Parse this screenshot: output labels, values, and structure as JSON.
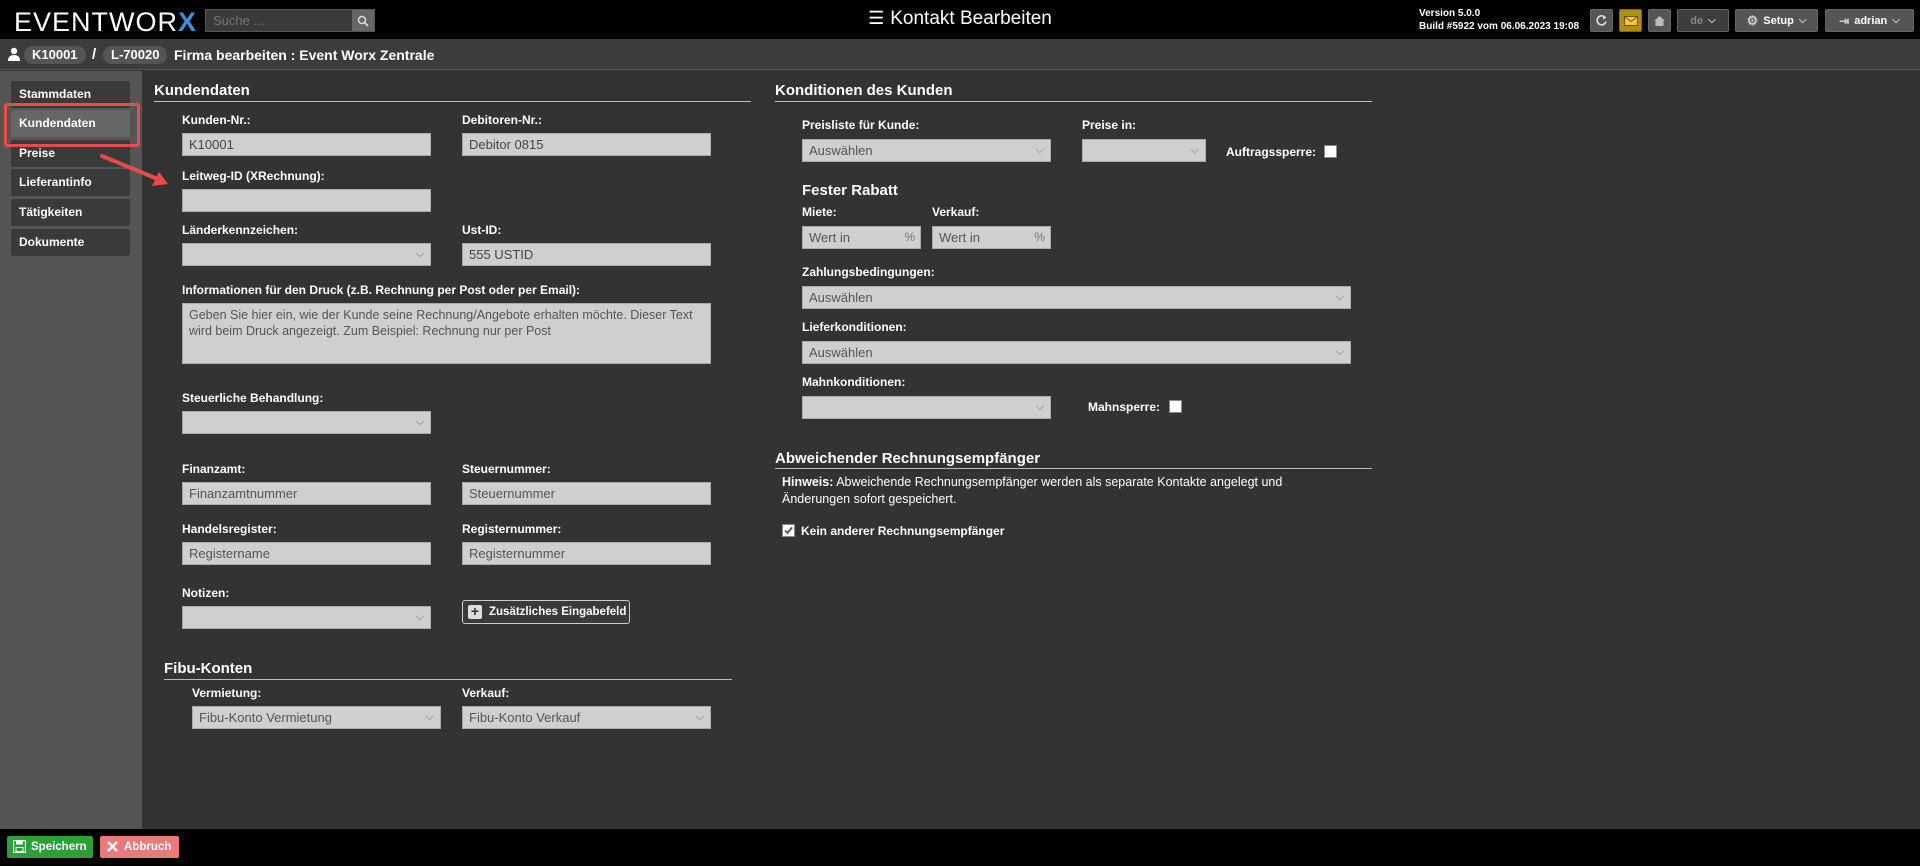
{
  "topbar": {
    "logo_text": "EVENTWOR",
    "logo_x": "X",
    "search_placeholder": "Suche ...",
    "page_title": "Kontakt Bearbeiten",
    "version_line1": "Version 5.0.0",
    "version_line2": "Build #5922 vom 06.06.2023 19:08",
    "lang": "de",
    "setup_label": "Setup",
    "user_label": "adrian"
  },
  "breadcrumb": {
    "customer_id": "K10001",
    "separator": "/",
    "supplier_id": "L-70020",
    "title": "Firma bearbeiten : Event Worx Zentrale"
  },
  "nav": {
    "items": [
      {
        "label": "Stammdaten"
      },
      {
        "label": "Kundendaten"
      },
      {
        "label": "Preise"
      },
      {
        "label": "Lieferantinfo"
      },
      {
        "label": "Tätigkeiten"
      },
      {
        "label": "Dokumente"
      }
    ]
  },
  "kundendaten": {
    "title": "Kundendaten",
    "kunden_nr_label": "Kunden-Nr.:",
    "kunden_nr_value": "K10001",
    "debitoren_nr_label": "Debitoren-Nr.:",
    "debitoren_nr_value": "Debitor 0815",
    "leitweg_label": "Leitweg-ID (XRechnung):",
    "laender_label": "Länderkennzeichen:",
    "ustid_label": "Ust-ID:",
    "ustid_value": "555 USTID",
    "druck_label": "Informationen für den Druck (z.B. Rechnung per Post oder per Email):",
    "druck_placeholder": "Geben Sie hier ein, wie der Kunde seine Rechnung/Angebote erhalten möchte. Dieser Text wird beim Druck angezeigt. Zum Beispiel: Rechnung nur per Post",
    "steuer_label": "Steuerliche Behandlung:",
    "finanzamt_label": "Finanzamt:",
    "finanzamt_placeholder": "Finanzamtnummer",
    "steuernummer_label": "Steuernummer:",
    "steuernummer_placeholder": "Steuernummer",
    "handelsregister_label": "Handelsregister:",
    "handelsregister_placeholder": "Registername",
    "registernummer_label": "Registernummer:",
    "registernummer_placeholder": "Registernummer",
    "notizen_label": "Notizen:",
    "add_field_label": "Zusätzliches Eingabefeld"
  },
  "fibu": {
    "title": "Fibu-Konten",
    "vermietung_label": "Vermietung:",
    "vermietung_value": "Fibu-Konto Vermietung",
    "verkauf_label": "Verkauf:",
    "verkauf_value": "Fibu-Konto Verkauf"
  },
  "konditionen": {
    "title": "Konditionen des Kunden",
    "preisliste_label": "Preisliste für Kunde:",
    "preisliste_value": "Auswählen",
    "preise_in_label": "Preise in:",
    "auftragssperre_label": "Auftragssperre:",
    "rabatt_title": "Fester Rabatt",
    "miete_label": "Miete:",
    "miete_placeholder": "Wert in",
    "verkauf_label": "Verkauf:",
    "verkauf_placeholder": "Wert in",
    "pct": "%",
    "zahlung_label": "Zahlungsbedingungen:",
    "zahlung_value": "Auswählen",
    "liefer_label": "Lieferkonditionen:",
    "liefer_value": "Auswählen",
    "mahn_label": "Mahnkonditionen:",
    "mahnsperre_label": "Mahnsperre:"
  },
  "abweichend": {
    "title": "Abweichender Rechnungsempfänger",
    "hint_bold": "Hinweis:",
    "hint_text": " Abweichende Rechnungsempfänger werden als separate Kontakte angelegt und Änderungen sofort gespeichert.",
    "checkbox_label": "Kein anderer Rechnungsempfänger"
  },
  "footer": {
    "save_label": "Speichern",
    "cancel_label": "Abbruch"
  },
  "colors": {
    "accent_blue": "#3d8fd6",
    "highlight_red": "#e94a4a",
    "save_green": "#2e9e3a",
    "cancel_red": "#e77a7a"
  }
}
